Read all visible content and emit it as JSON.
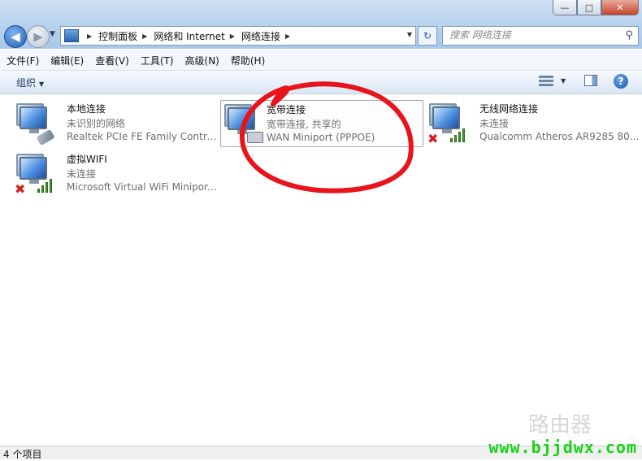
{
  "window": {
    "controls": {
      "minimize": "—",
      "maximize": "□",
      "close": "✕"
    }
  },
  "nav": {
    "back_icon": "arrow-left-icon",
    "forward_icon": "arrow-right-icon",
    "breadcrumb": [
      "控制面板",
      "网络和 Internet",
      "网络连接"
    ],
    "search_placeholder": "搜索 网络连接"
  },
  "menu": [
    "文件(F)",
    "编辑(E)",
    "查看(V)",
    "工具(T)",
    "高级(N)",
    "帮助(H)"
  ],
  "toolbar": {
    "organize": "组织",
    "help": "?"
  },
  "connections": [
    {
      "name": "本地连接",
      "status": "未识别的网络",
      "device": "Realtek PCIe FE Family Control...",
      "icon": "wired-network-icon"
    },
    {
      "name": "宽带连接",
      "status": "宽带连接, 共享的",
      "device": "WAN Miniport (PPPOE)",
      "icon": "broadband-icon",
      "selected": true
    },
    {
      "name": "无线网络连接",
      "status": "未连接",
      "device": "Qualcomm Atheros AR9285 80...",
      "icon": "wireless-network-icon",
      "disconnected": true
    },
    {
      "name": "虚拟WIFI",
      "status": "未连接",
      "device": "Microsoft Virtual WiFi Minipor...",
      "icon": "wireless-network-icon",
      "disconnected": true
    }
  ],
  "status_bar": {
    "count": "4 个项目"
  },
  "watermark": {
    "text": "www.bjjdwx.com",
    "logo_text": "路由器"
  },
  "colors": {
    "annotation": "#e8131b",
    "watermark": "#18d318",
    "selection_border": "#9da9b8"
  }
}
